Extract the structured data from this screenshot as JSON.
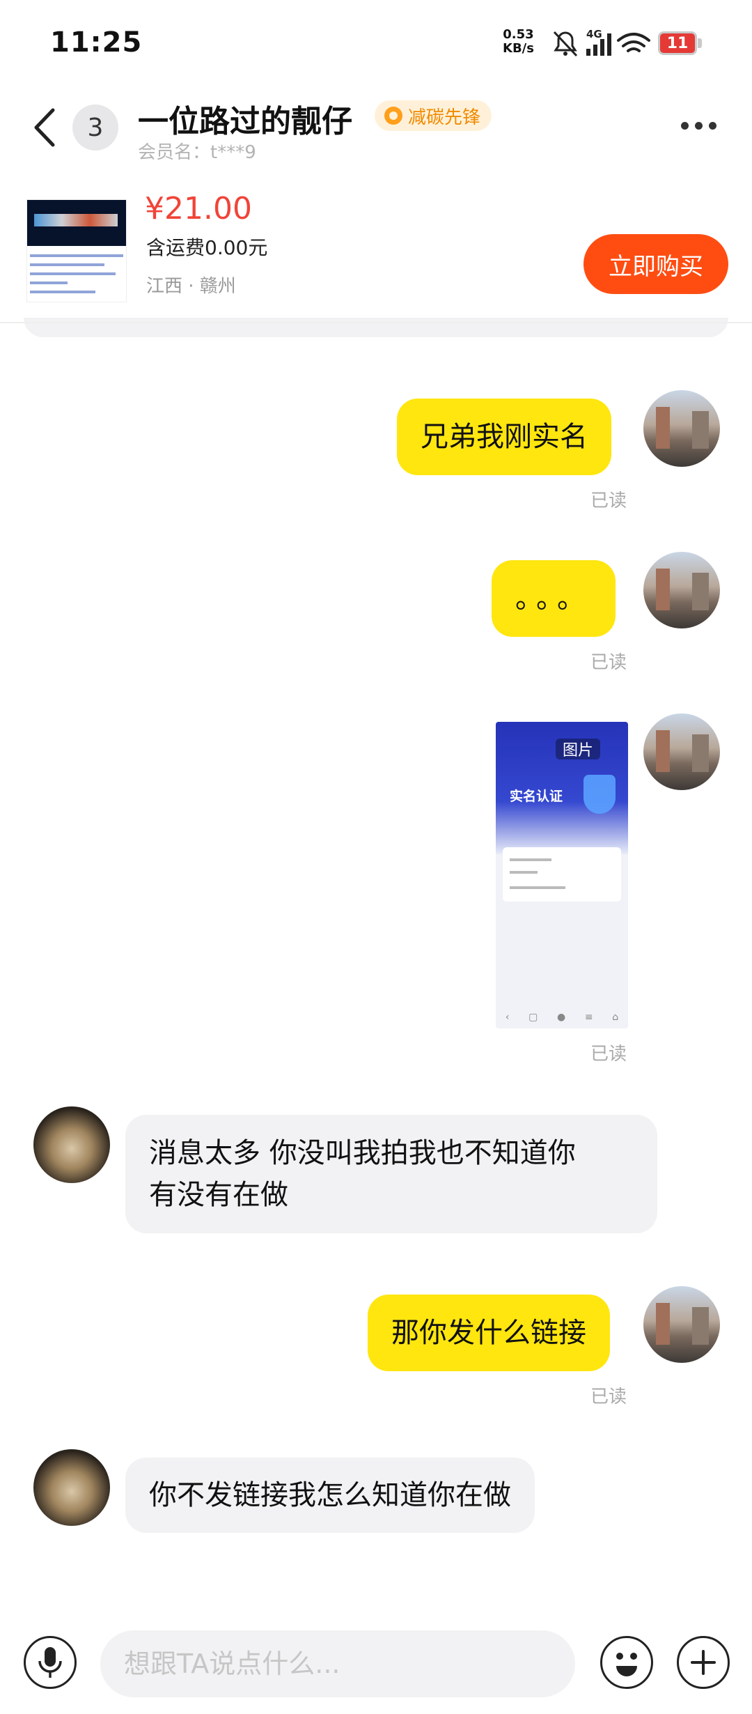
{
  "status_bar": {
    "time": "11:25",
    "net_speed_value": "0.53",
    "net_speed_unit": "KB/s",
    "network": "4G",
    "battery": "11",
    "battery_color": "#e53935"
  },
  "header": {
    "back_icon": "chevron-left-icon",
    "unread_count": "3",
    "title": "一位路过的靓仔",
    "badge": "减碳先锋",
    "member_label": "会员名：t***9",
    "more_icon": "more-icon"
  },
  "product": {
    "price": "¥21.00",
    "shipping": "含运费0.00元",
    "location": "江西 · 赣州",
    "buy_label": "立即购买",
    "buy_color": "#ff4d12"
  },
  "messages": [
    {
      "from": "me",
      "type": "text",
      "text": "兄弟我刚实名",
      "status": "已读"
    },
    {
      "from": "me",
      "type": "text",
      "text": "。。。",
      "status": "已读"
    },
    {
      "from": "me",
      "type": "image",
      "tag": "图片",
      "image_title": "实名认证",
      "status": "已读"
    },
    {
      "from": "other",
      "type": "text",
      "line1": "消息太多 你没叫我拍我也不知道你",
      "line2": "有没有在做"
    },
    {
      "from": "me",
      "type": "text",
      "text": "那你发什么链接",
      "status": "已读"
    },
    {
      "from": "other",
      "type": "text",
      "text": "你不发链接我怎么知道你在做"
    }
  ],
  "input_bar": {
    "placeholder": "想跟TA说点什么...",
    "mic_icon": "microphone-icon",
    "emoji_icon": "emoji-icon",
    "plus_icon": "plus-icon"
  },
  "colors": {
    "self_bubble": "#ffe60f",
    "other_bubble": "#f2f2f4",
    "price": "#f04438"
  }
}
